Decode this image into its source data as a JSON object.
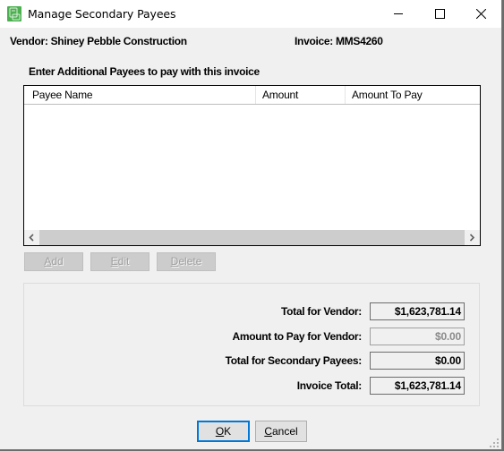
{
  "window": {
    "title": "Manage Secondary Payees",
    "app_icon": "app-icon",
    "controls": [
      "minimize-icon",
      "maximize-icon",
      "close-icon"
    ]
  },
  "header": {
    "vendor_label": "Vendor:  Shiney Pebble Construction",
    "invoice_label": "Invoice:  MMS4260"
  },
  "payees": {
    "section_label": "Enter Additional Payees to pay with this invoice",
    "columns": [
      "Payee Name",
      "Amount",
      "Amount To Pay"
    ],
    "rows": []
  },
  "actions": {
    "add": {
      "access_key": "A",
      "rest": "dd",
      "enabled": false
    },
    "edit": {
      "access_key": "E",
      "rest": "dit",
      "enabled": false
    },
    "delete": {
      "access_key": "D",
      "rest": "elete",
      "enabled": false
    }
  },
  "summary": {
    "rows": [
      {
        "label": "Total for Vendor:",
        "value": "$1,623,781.14",
        "enabled": true
      },
      {
        "label": "Amount to Pay for Vendor:",
        "value": "$0.00",
        "enabled": false
      },
      {
        "label": "Total for Secondary Payees:",
        "value": "$0.00",
        "enabled": true
      },
      {
        "label": "Invoice Total:",
        "value": "$1,623,781.14",
        "enabled": true
      }
    ]
  },
  "footer": {
    "ok": {
      "access_key": "O",
      "rest": "K"
    },
    "cancel": {
      "access_key": "C",
      "rest": "ancel"
    }
  },
  "colors": {
    "accent_focus": "#0078d7",
    "app_icon": "#4caf50",
    "dialog_bg": "#f0f0f0"
  }
}
